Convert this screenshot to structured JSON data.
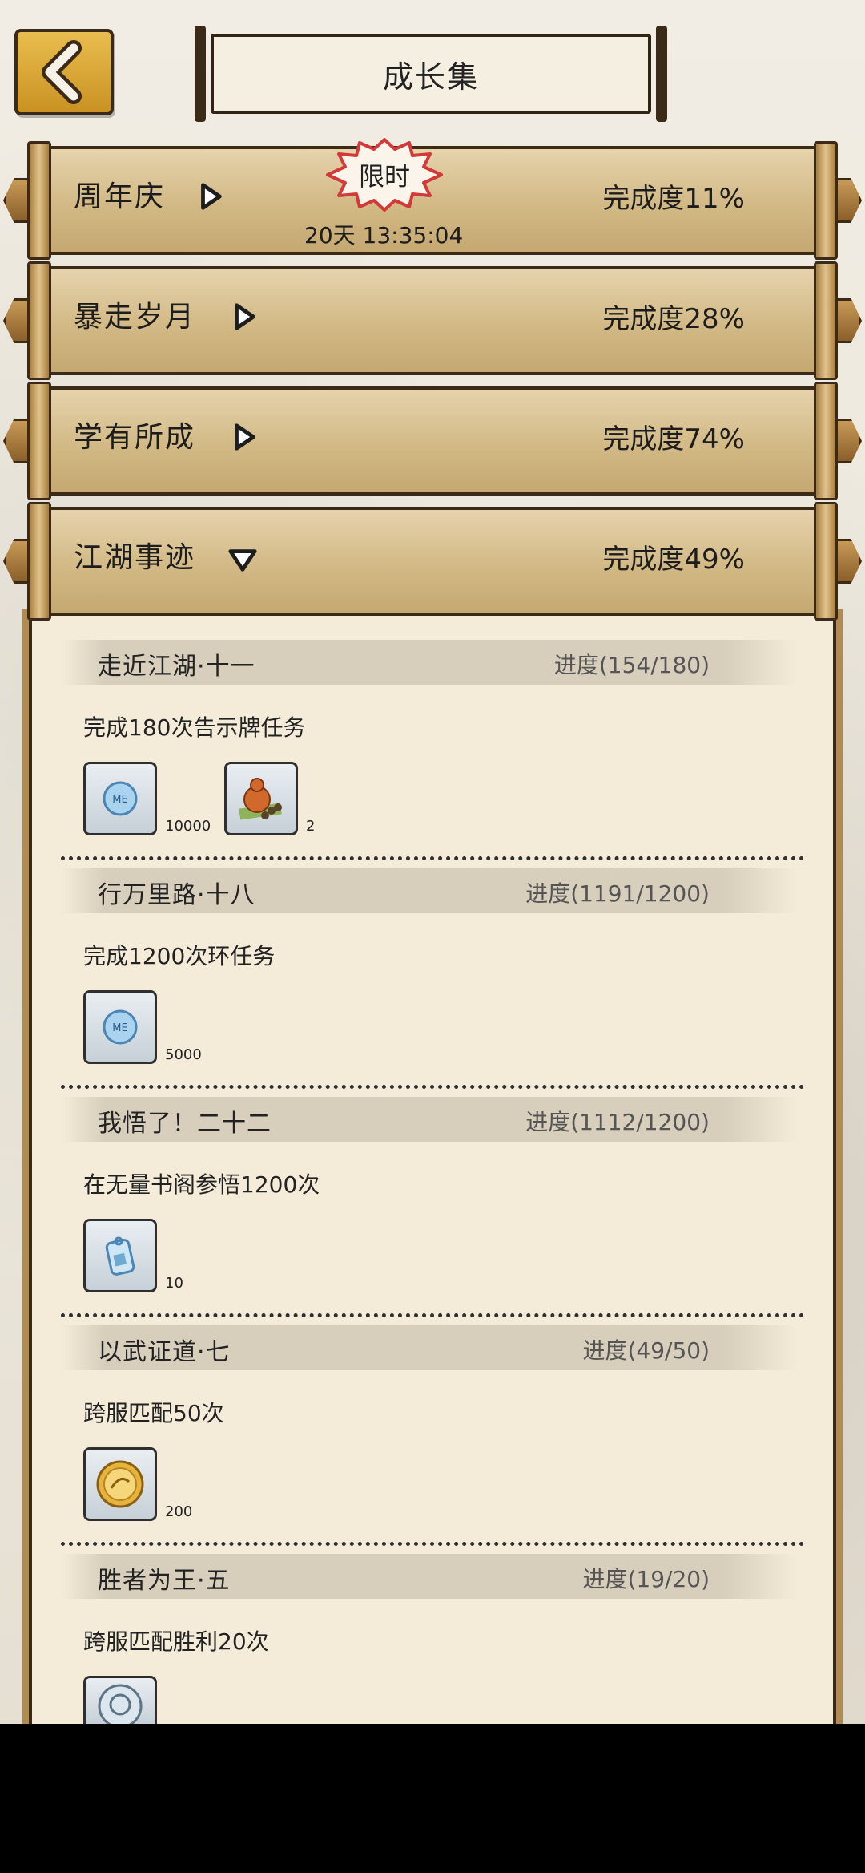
{
  "header": {
    "title": "成长集"
  },
  "categories": [
    {
      "name": "周年庆",
      "completion": "完成度11%",
      "badge": "限时",
      "timer": "20天 13:35:04"
    },
    {
      "name": "暴走岁月",
      "completion": "完成度28%"
    },
    {
      "name": "学有所成",
      "completion": "完成度74%"
    },
    {
      "name": "江湖事迹",
      "completion": "完成度49%"
    }
  ],
  "tasks": [
    {
      "title": "走近江湖·十一",
      "progress": "进度(154/180)",
      "desc": "完成180次告示牌任务",
      "rewards": [
        {
          "icon": "silver-coin-icon",
          "count": "10000"
        },
        {
          "icon": "gourd-bundle-icon",
          "count": "2"
        }
      ]
    },
    {
      "title": "行万里路·十八",
      "progress": "进度(1191/1200)",
      "desc": "完成1200次环任务",
      "rewards": [
        {
          "icon": "silver-coin-icon",
          "count": "5000"
        }
      ]
    },
    {
      "title": "我悟了！二十二",
      "progress": "进度(1112/1200)",
      "desc": "在无量书阁参悟1200次",
      "rewards": [
        {
          "icon": "token-tag-icon",
          "count": "10"
        }
      ]
    },
    {
      "title": "以武证道·七",
      "progress": "进度(49/50)",
      "desc": "跨服匹配50次",
      "rewards": [
        {
          "icon": "gold-medal-icon",
          "count": "200"
        }
      ]
    },
    {
      "title": "胜者为王·五",
      "progress": "进度(19/20)",
      "desc": "跨服匹配胜利20次",
      "rewards": [
        {
          "icon": "portrait-medal-icon",
          "count": ""
        }
      ]
    }
  ],
  "colors": {
    "bar": "#d2b985",
    "panel": "#f4ecd9",
    "back_button": "#e0ad3a",
    "outline": "#3a2a17"
  }
}
